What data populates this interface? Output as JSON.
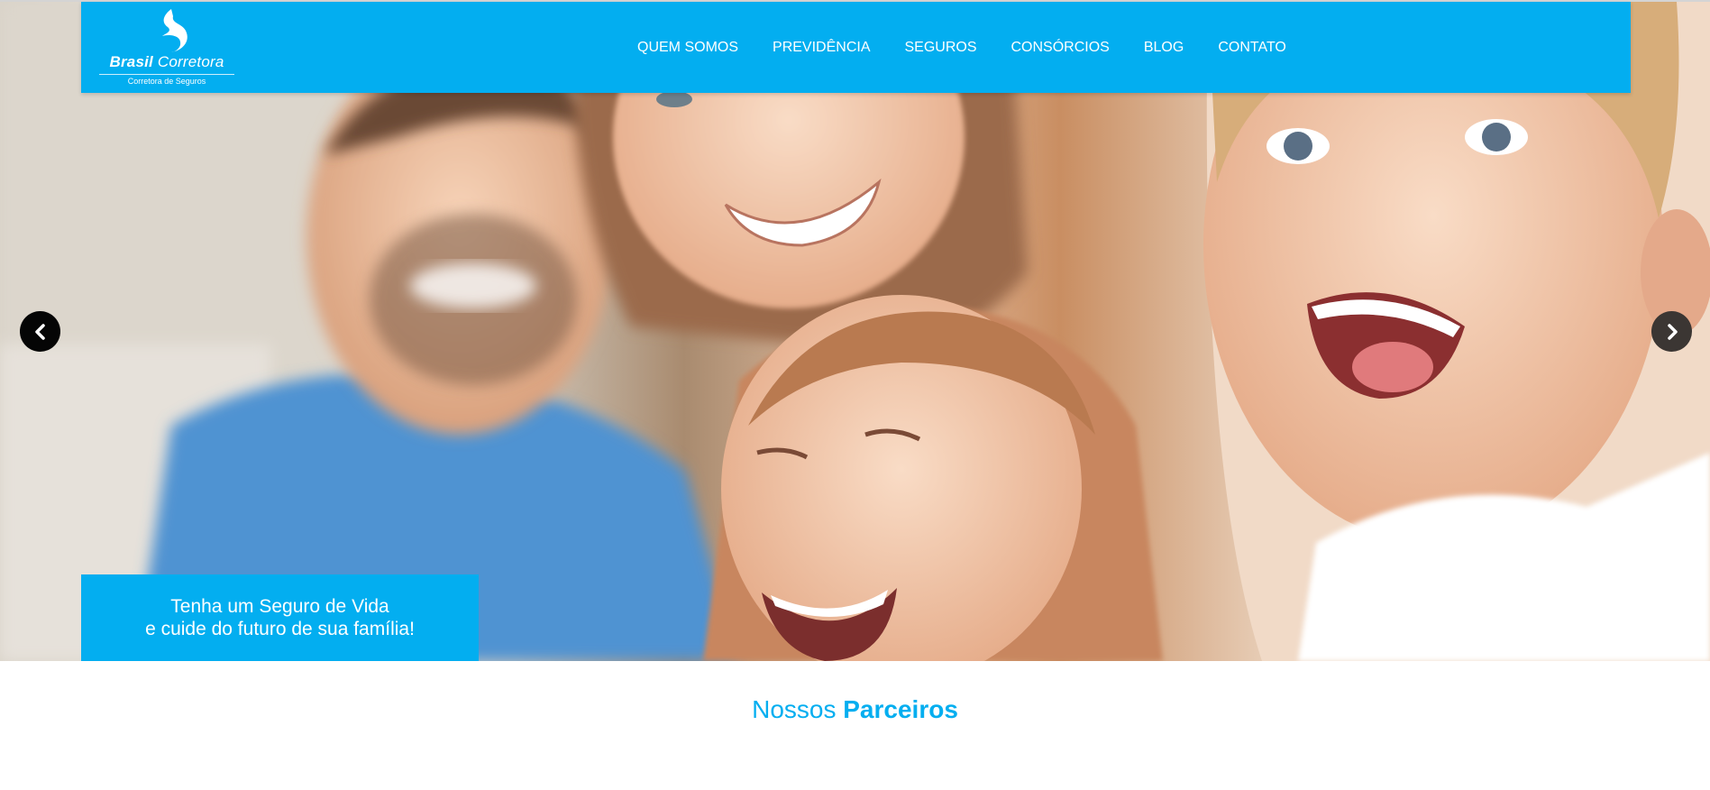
{
  "colors": {
    "brand": "#03aef0",
    "white": "#ffffff"
  },
  "logo": {
    "name_bold": "Brasil",
    "name_regular": "Corretora",
    "tagline": "Corretora de Seguros",
    "icon": "flame-logo-icon"
  },
  "nav": {
    "items": [
      {
        "label": "QUEM SOMOS"
      },
      {
        "label": "PREVIDÊNCIA"
      },
      {
        "label": "SEGUROS"
      },
      {
        "label": "CONSÓRCIOS"
      },
      {
        "label": "BLOG"
      },
      {
        "label": "CONTATO"
      }
    ]
  },
  "carousel": {
    "prev_icon": "chevron-left-icon",
    "next_icon": "chevron-right-icon",
    "caption_line1": "Tenha um Seguro de Vida",
    "caption_line2": "e cuide do futuro de sua família!"
  },
  "partners": {
    "title_light": "Nossos",
    "title_bold": "Parceiros"
  }
}
